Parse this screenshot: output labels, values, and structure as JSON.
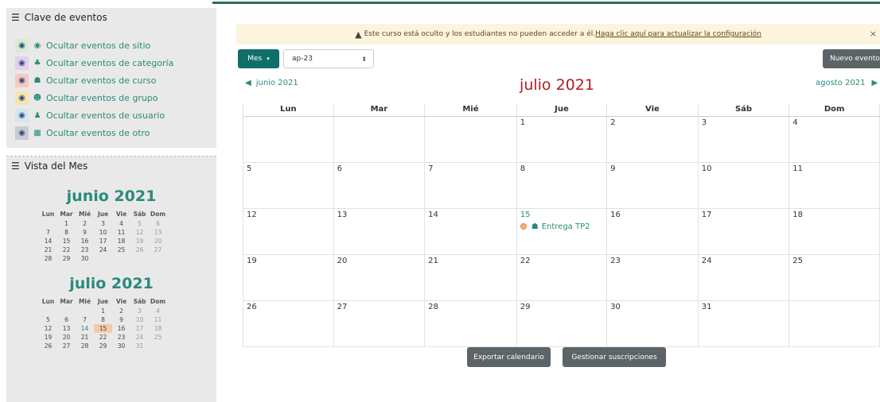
{
  "sidebar": {
    "key_block": {
      "title": "Clave de eventos",
      "items": [
        {
          "label": "Ocultar eventos de sitio",
          "icon": "globe-icon",
          "glyph": "◉",
          "color": "#d8ecd5"
        },
        {
          "label": "Ocultar eventos de categoría",
          "icon": "cubes-icon",
          "glyph": "♣",
          "color": "#e1d0ec"
        },
        {
          "label": "Ocultar eventos de curso",
          "icon": "graduation-cap-icon",
          "glyph": "☗",
          "color": "#f6c9c0"
        },
        {
          "label": "Ocultar eventos de grupo",
          "icon": "users-icon",
          "glyph": "☻",
          "color": "#f7e4ae"
        },
        {
          "label": "Ocultar eventos de usuario",
          "icon": "user-icon",
          "glyph": "♟",
          "color": "#d6e5ef"
        },
        {
          "label": "Ocultar eventos de otro",
          "icon": "calendar-icon",
          "glyph": "▦",
          "color": "#c9ccd4"
        }
      ]
    },
    "month_block": {
      "title": "Vista del Mes",
      "weekdays": [
        "Lun",
        "Mar",
        "Mié",
        "Jue",
        "Vie",
        "Sáb",
        "Dom"
      ],
      "months": [
        {
          "title": "junio 2021",
          "weeks": [
            [
              "",
              "1",
              "2",
              "3",
              "4",
              "5",
              "6"
            ],
            [
              "7",
              "8",
              "9",
              "10",
              "11",
              "12",
              "13"
            ],
            [
              "14",
              "15",
              "16",
              "17",
              "18",
              "19",
              "20"
            ],
            [
              "21",
              "22",
              "23",
              "24",
              "25",
              "26",
              "27"
            ],
            [
              "28",
              "29",
              "30",
              "",
              "",
              "",
              ""
            ]
          ]
        },
        {
          "title": "julio 2021",
          "weeks": [
            [
              "",
              "",
              "",
              "1",
              "2",
              "3",
              "4"
            ],
            [
              "5",
              "6",
              "7",
              "8",
              "9",
              "10",
              "11"
            ],
            [
              "12",
              "13",
              "14",
              "15",
              "16",
              "17",
              "18"
            ],
            [
              "19",
              "20",
              "21",
              "22",
              "23",
              "24",
              "25"
            ],
            [
              "26",
              "27",
              "28",
              "29",
              "30",
              "31",
              ""
            ]
          ],
          "link_days": [
            "14"
          ],
          "highlight_day": "15"
        }
      ]
    }
  },
  "alert": {
    "text": "Este curso está oculto y los estudiantes no pueden acceder a él.",
    "link": "Haga clic aquí para actualizar la configuración",
    "close": "×"
  },
  "toolbar": {
    "view_button": "Mes",
    "course_select": "ap-23",
    "new_event": "Nuevo evento"
  },
  "calendar": {
    "prev": "junio 2021",
    "next": "agosto 2021",
    "title": "julio 2021",
    "weekdays": [
      "Lun",
      "Mar",
      "Mié",
      "Jue",
      "Vie",
      "Sáb",
      "Dom"
    ],
    "weeks": [
      [
        "",
        "",
        "",
        "1",
        "2",
        "3",
        "4"
      ],
      [
        "5",
        "6",
        "7",
        "8",
        "9",
        "10",
        "11"
      ],
      [
        "12",
        "13",
        "14",
        "15",
        "16",
        "17",
        "18"
      ],
      [
        "19",
        "20",
        "21",
        "22",
        "23",
        "24",
        "25"
      ],
      [
        "26",
        "27",
        "28",
        "29",
        "30",
        "31",
        ""
      ]
    ],
    "event": {
      "day": "15",
      "label": "Entrega TP2"
    }
  },
  "footer": {
    "export": "Exportar calendario",
    "subscriptions": "Gestionar suscripciones"
  },
  "colors": {
    "accent": "#2a8a7c",
    "title_red": "#b01e1e",
    "primary_button": "#0f6e6a"
  }
}
